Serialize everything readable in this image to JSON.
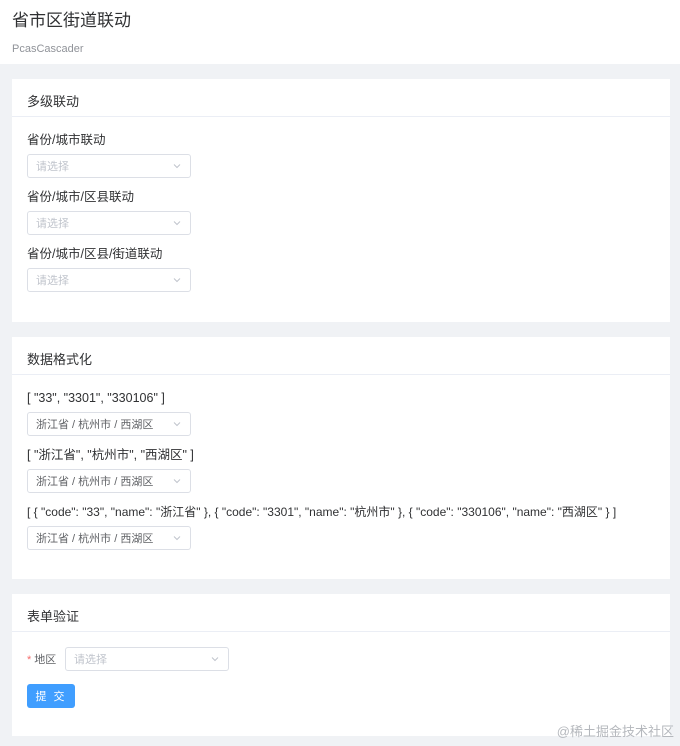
{
  "header": {
    "title": "省市区街道联动",
    "subtitle": "PcasCascader"
  },
  "sections": {
    "multilevel": {
      "title": "多级联动",
      "fields": [
        {
          "label": "省份/城市联动",
          "placeholder": "请选择"
        },
        {
          "label": "省份/城市/区县联动",
          "placeholder": "请选择"
        },
        {
          "label": "省份/城市/区县/街道联动",
          "placeholder": "请选择"
        }
      ]
    },
    "format": {
      "title": "数据格式化",
      "fields": [
        {
          "label": "[ \"33\", \"3301\", \"330106\" ]",
          "value": "浙江省 / 杭州市 / 西湖区"
        },
        {
          "label": "[ \"浙江省\", \"杭州市\", \"西湖区\" ]",
          "value": "浙江省 / 杭州市 / 西湖区"
        },
        {
          "label": "[ { \"code\": \"33\", \"name\": \"浙江省\" }, { \"code\": \"3301\", \"name\": \"杭州市\" }, { \"code\": \"330106\", \"name\": \"西湖区\" } ]",
          "value": "浙江省 / 杭州市 / 西湖区"
        }
      ]
    },
    "validation": {
      "title": "表单验证",
      "required_mark": "*",
      "region_label": "地区",
      "region_placeholder": "请选择",
      "submit_label": "提 交"
    }
  },
  "watermark": "@稀土掘金技术社区",
  "colors": {
    "primary": "#409eff",
    "required": "#f56c6c",
    "background": "#f0f2f5"
  }
}
